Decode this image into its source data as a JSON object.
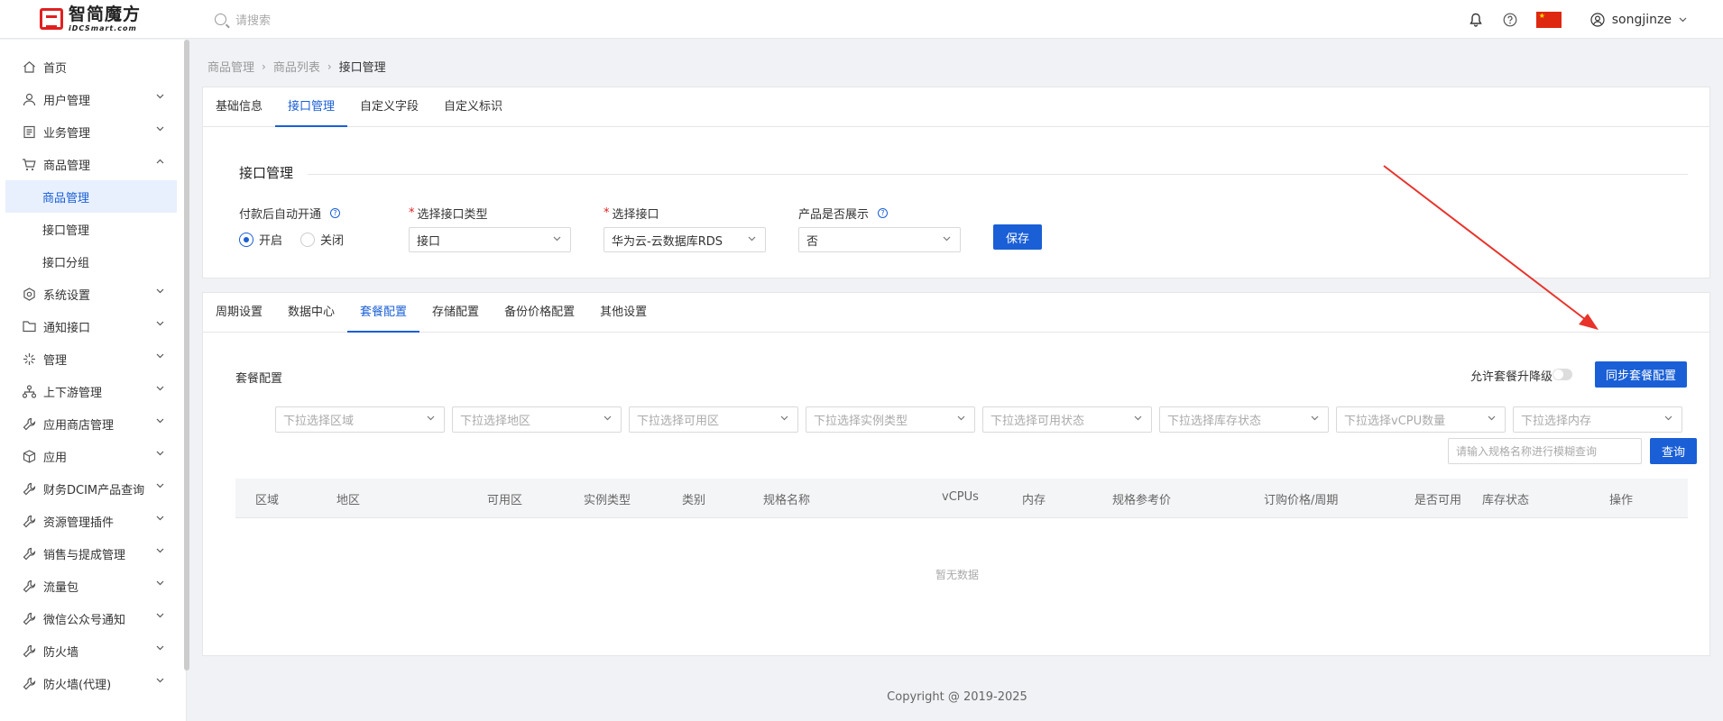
{
  "header": {
    "logo_cn": "智简魔方",
    "logo_en": "iDCSmart.com",
    "search_placeholder": "请搜索",
    "username": "songjinze"
  },
  "sidebar": {
    "items": [
      {
        "label": "首页",
        "icon": "home-icon"
      },
      {
        "label": "用户管理",
        "icon": "user-icon"
      },
      {
        "label": "业务管理",
        "icon": "document-icon"
      },
      {
        "label": "商品管理",
        "icon": "cart-icon"
      },
      {
        "label": "商品管理"
      },
      {
        "label": "接口管理"
      },
      {
        "label": "接口分组"
      },
      {
        "label": "系统设置",
        "icon": "settings-icon"
      },
      {
        "label": "通知接口",
        "icon": "folder-icon"
      },
      {
        "label": "管理",
        "icon": "spark-icon"
      },
      {
        "label": "上下游管理",
        "icon": "hierarchy-icon"
      },
      {
        "label": "应用商店管理",
        "icon": "wrench-icon"
      },
      {
        "label": "应用",
        "icon": "box-icon"
      },
      {
        "label": "财务DCIM产品查询",
        "icon": "wrench-icon"
      },
      {
        "label": "资源管理插件",
        "icon": "wrench-icon"
      },
      {
        "label": "销售与提成管理",
        "icon": "wrench-icon"
      },
      {
        "label": "流量包",
        "icon": "wrench-icon"
      },
      {
        "label": "微信公众号通知",
        "icon": "wrench-icon"
      },
      {
        "label": "防火墙",
        "icon": "wrench-icon"
      },
      {
        "label": "防火墙(代理)",
        "icon": "wrench-icon"
      }
    ]
  },
  "breadcrumb": [
    "商品管理",
    "商品列表",
    "接口管理"
  ],
  "top_tabs": [
    "基础信息",
    "接口管理",
    "自定义字段",
    "自定义标识"
  ],
  "interface": {
    "section_title": "接口管理",
    "auto_open_label": "付款后自动开通",
    "radio_on": "开启",
    "radio_off": "关闭",
    "type_label": "选择接口类型",
    "type_value": "接口",
    "api_label": "选择接口",
    "api_value": "华为云-云数据库RDS",
    "show_label": "产品是否展示",
    "show_value": "否",
    "save": "保存"
  },
  "bottom_tabs": [
    "周期设置",
    "数据中心",
    "套餐配置",
    "存储配置",
    "备份价格配置",
    "其他设置"
  ],
  "package": {
    "title": "套餐配置",
    "allow_downgrade": "允许套餐升降级",
    "sync_button": "同步套餐配置",
    "filters": [
      "下拉选择区域",
      "下拉选择地区",
      "下拉选择可用区",
      "下拉选择实例类型",
      "下拉选择可用状态",
      "下拉选择库存状态",
      "下拉选择vCPU数量",
      "下拉选择内存"
    ],
    "search_placeholder": "请输入规格名称进行模糊查询",
    "query": "查询",
    "columns": [
      "区域",
      "地区",
      "可用区",
      "实例类型",
      "类别",
      "规格名称",
      "vCPUs",
      "内存",
      "规格参考价",
      "订购价格/周期",
      "是否可用",
      "库存状态",
      "操作"
    ],
    "empty": "暂无数据"
  },
  "footer": "Copyright @ 2019-2025",
  "colors": {
    "primary": "#1a5fd6",
    "arrow": "#e8332a"
  }
}
